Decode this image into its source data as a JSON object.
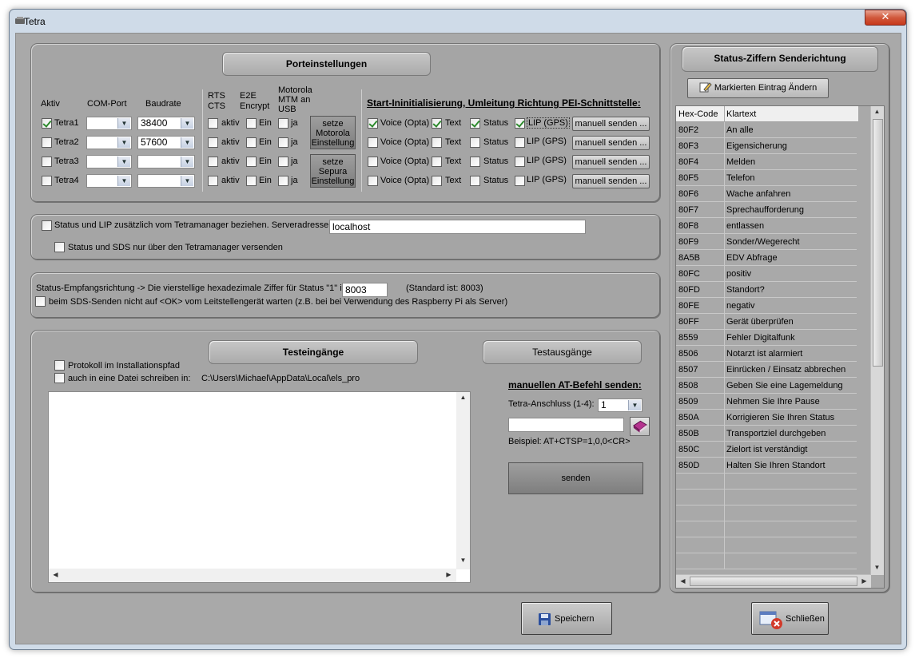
{
  "window": {
    "title": "Tetra",
    "close_symbol": "✕"
  },
  "ports": {
    "header": "Porteinstellungen",
    "col_aktiv": "Aktiv",
    "col_com": "COM-Port",
    "col_baud": "Baudrate",
    "col_rts": "RTS\nCTS",
    "col_e2e": "E2E\nEncrypt",
    "col_mtm": "Motorola\nMTM an\nUSB",
    "start_title": "Start-Ininitialisierung, Umleitung Richtung PEI-Schnittstelle:",
    "rows": [
      {
        "name": "Tetra1",
        "active": true,
        "baud": "38400",
        "rts": "aktiv",
        "e2e": "Ein",
        "mtm": "ja",
        "voice": "Voice (Opta)",
        "voice_on": true,
        "text": "Text",
        "text_on": true,
        "status": "Status",
        "status_on": true,
        "lip": "LIP (GPS)",
        "lip_on": true,
        "send": "manuell senden ..."
      },
      {
        "name": "Tetra2",
        "active": false,
        "baud": "57600",
        "rts": "aktiv",
        "e2e": "Ein",
        "mtm": "ja",
        "voice": "Voice (Opta)",
        "voice_on": false,
        "text": "Text",
        "text_on": false,
        "status": "Status",
        "status_on": false,
        "lip": "LIP (GPS)",
        "lip_on": false,
        "send": "manuell senden ..."
      },
      {
        "name": "Tetra3",
        "active": false,
        "baud": "",
        "rts": "aktiv",
        "e2e": "Ein",
        "mtm": "ja",
        "voice": "Voice (Opta)",
        "voice_on": false,
        "text": "Text",
        "text_on": false,
        "status": "Status",
        "status_on": false,
        "lip": "LIP (GPS)",
        "lip_on": false,
        "send": "manuell senden ..."
      },
      {
        "name": "Tetra4",
        "active": false,
        "baud": "",
        "rts": "aktiv",
        "e2e": "Ein",
        "mtm": "ja",
        "voice": "Voice (Opta)",
        "voice_on": false,
        "text": "Text",
        "text_on": false,
        "status": "Status",
        "status_on": false,
        "lip": "LIP (GPS)",
        "lip_on": false,
        "send": "manuell senden ..."
      }
    ],
    "btn_motorola": "setze\nMotorola\nEinstellung",
    "btn_sepura": "setze\nSepura\nEinstellung"
  },
  "server": {
    "lip_label": "Status und LIP zusätzlich vom Tetramanager beziehen. Serveradresse:",
    "address": "localhost",
    "sds_label": "Status und  SDS nur über den Tetramanager versenden"
  },
  "direction": {
    "label": "Status-Empfangsrichtung -> Die vierstellige hexadezimale Ziffer für Status \"1\" ist:",
    "value": "8003",
    "standard": "(Standard ist: 8003)",
    "sds_wait": "beim SDS-Senden nicht auf <OK> vom Leitstellengerät warten (z.B. bei bei Verwendung des Raspberry Pi als Server)"
  },
  "test": {
    "inputs_header": "Testeingänge",
    "outputs_header": "Testausgänge",
    "protocol_label": "Protokoll im Installationspfad",
    "file_label": "auch in eine Datei schreiben in:",
    "file_path": "C:\\Users\\Michael\\AppData\\Local\\els_pro",
    "at_title": "manuellen AT-Befehl senden:",
    "port_label": "Tetra-Anschluss (1-4):",
    "port_value": "1",
    "example": "Beispiel: AT+CTSP=1,0,0<CR>",
    "send_btn": "senden"
  },
  "status_digits": {
    "header": "Status-Ziffern Senderichtung",
    "edit_btn": "Markierten Eintrag Ändern",
    "col_hex": "Hex-Code",
    "col_text": "Klartext",
    "rows": [
      {
        "hex": "80F2",
        "text": "An alle"
      },
      {
        "hex": "80F3",
        "text": "Eigensicherung"
      },
      {
        "hex": "80F4",
        "text": "Melden"
      },
      {
        "hex": "80F5",
        "text": "Telefon"
      },
      {
        "hex": "80F6",
        "text": "Wache anfahren"
      },
      {
        "hex": "80F7",
        "text": "Sprechaufforderung"
      },
      {
        "hex": "80F8",
        "text": "entlassen"
      },
      {
        "hex": "80F9",
        "text": "Sonder/Wegerecht"
      },
      {
        "hex": "8A5B",
        "text": "EDV Abfrage"
      },
      {
        "hex": "80FC",
        "text": "positiv"
      },
      {
        "hex": "80FD",
        "text": "Standort?"
      },
      {
        "hex": "80FE",
        "text": "negativ"
      },
      {
        "hex": "80FF",
        "text": "Gerät überprüfen"
      },
      {
        "hex": "8559",
        "text": "Fehler Digitalfunk"
      },
      {
        "hex": "8506",
        "text": "Notarzt ist alarmiert"
      },
      {
        "hex": "8507",
        "text": "Einrücken / Einsatz abbrechen"
      },
      {
        "hex": "8508",
        "text": "Geben Sie eine Lagemeldung"
      },
      {
        "hex": "8509",
        "text": "Nehmen Sie Ihre Pause"
      },
      {
        "hex": "850A",
        "text": "Korrigieren Sie Ihren Status"
      },
      {
        "hex": "850B",
        "text": "Transportziel durchgeben"
      },
      {
        "hex": "850C",
        "text": "Zielort ist verständigt"
      },
      {
        "hex": "850D",
        "text": "Halten Sie Ihren Standort"
      }
    ]
  },
  "footer": {
    "save": "Speichern",
    "close": "Schließen"
  }
}
